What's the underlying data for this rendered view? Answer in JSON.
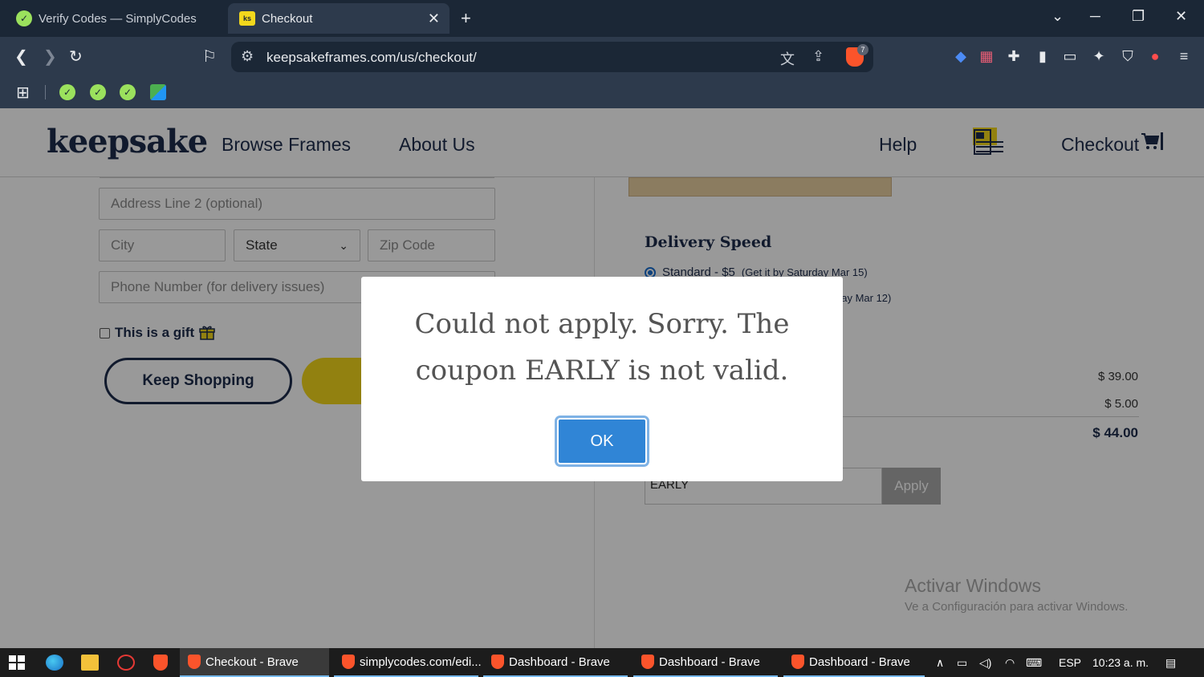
{
  "browser": {
    "tabs": [
      {
        "title": "Verify Codes — SimplyCodes",
        "active": false
      },
      {
        "title": "Checkout",
        "active": true
      }
    ],
    "url": "keepsakeframes.com/us/checkout/",
    "brave_badge": "7",
    "ext_badge": "1"
  },
  "site": {
    "logo": "keepsake",
    "nav": {
      "browse": "Browse Frames",
      "about": "About Us",
      "help": "Help",
      "checkout": "Checkout"
    }
  },
  "form": {
    "address2_placeholder": "Address Line 2 (optional)",
    "city_placeholder": "City",
    "state_value": "State",
    "zip_placeholder": "Zip Code",
    "phone_placeholder": "Phone Number (for delivery issues)",
    "gift_label": "This is a gift",
    "keep_shopping": "Keep Shopping"
  },
  "summary": {
    "delivery_title": "Delivery Speed",
    "standard_label": "Standard - $5",
    "standard_sub": "(Get it by Saturday Mar 15)",
    "expedited_sub_visible": "day Mar 12)",
    "subtotal": "$ 39.00",
    "shipping": "$ 5.00",
    "total": "$ 44.00",
    "coupon_value": "EARLY",
    "apply_label": "Apply"
  },
  "dialog": {
    "message": "Could not apply. Sorry. The coupon EARLY is not valid.",
    "ok_label": "OK"
  },
  "watermark": {
    "line1": "Activar Windows",
    "line2": "Ve a Configuración para activar Windows."
  },
  "taskbar": {
    "tasks": [
      {
        "label": "Checkout - Brave"
      },
      {
        "label": "simplycodes.com/edi..."
      },
      {
        "label": "Dashboard - Brave"
      },
      {
        "label": "Dashboard - Brave"
      },
      {
        "label": "Dashboard - Brave"
      }
    ],
    "language": "ESP",
    "time": "10:23 a. m."
  },
  "colors": {
    "navy": "#1d2c4c",
    "brand_yellow": "#f3d81c",
    "ok_blue": "#3085d6",
    "brave_orange": "#fb542b"
  }
}
